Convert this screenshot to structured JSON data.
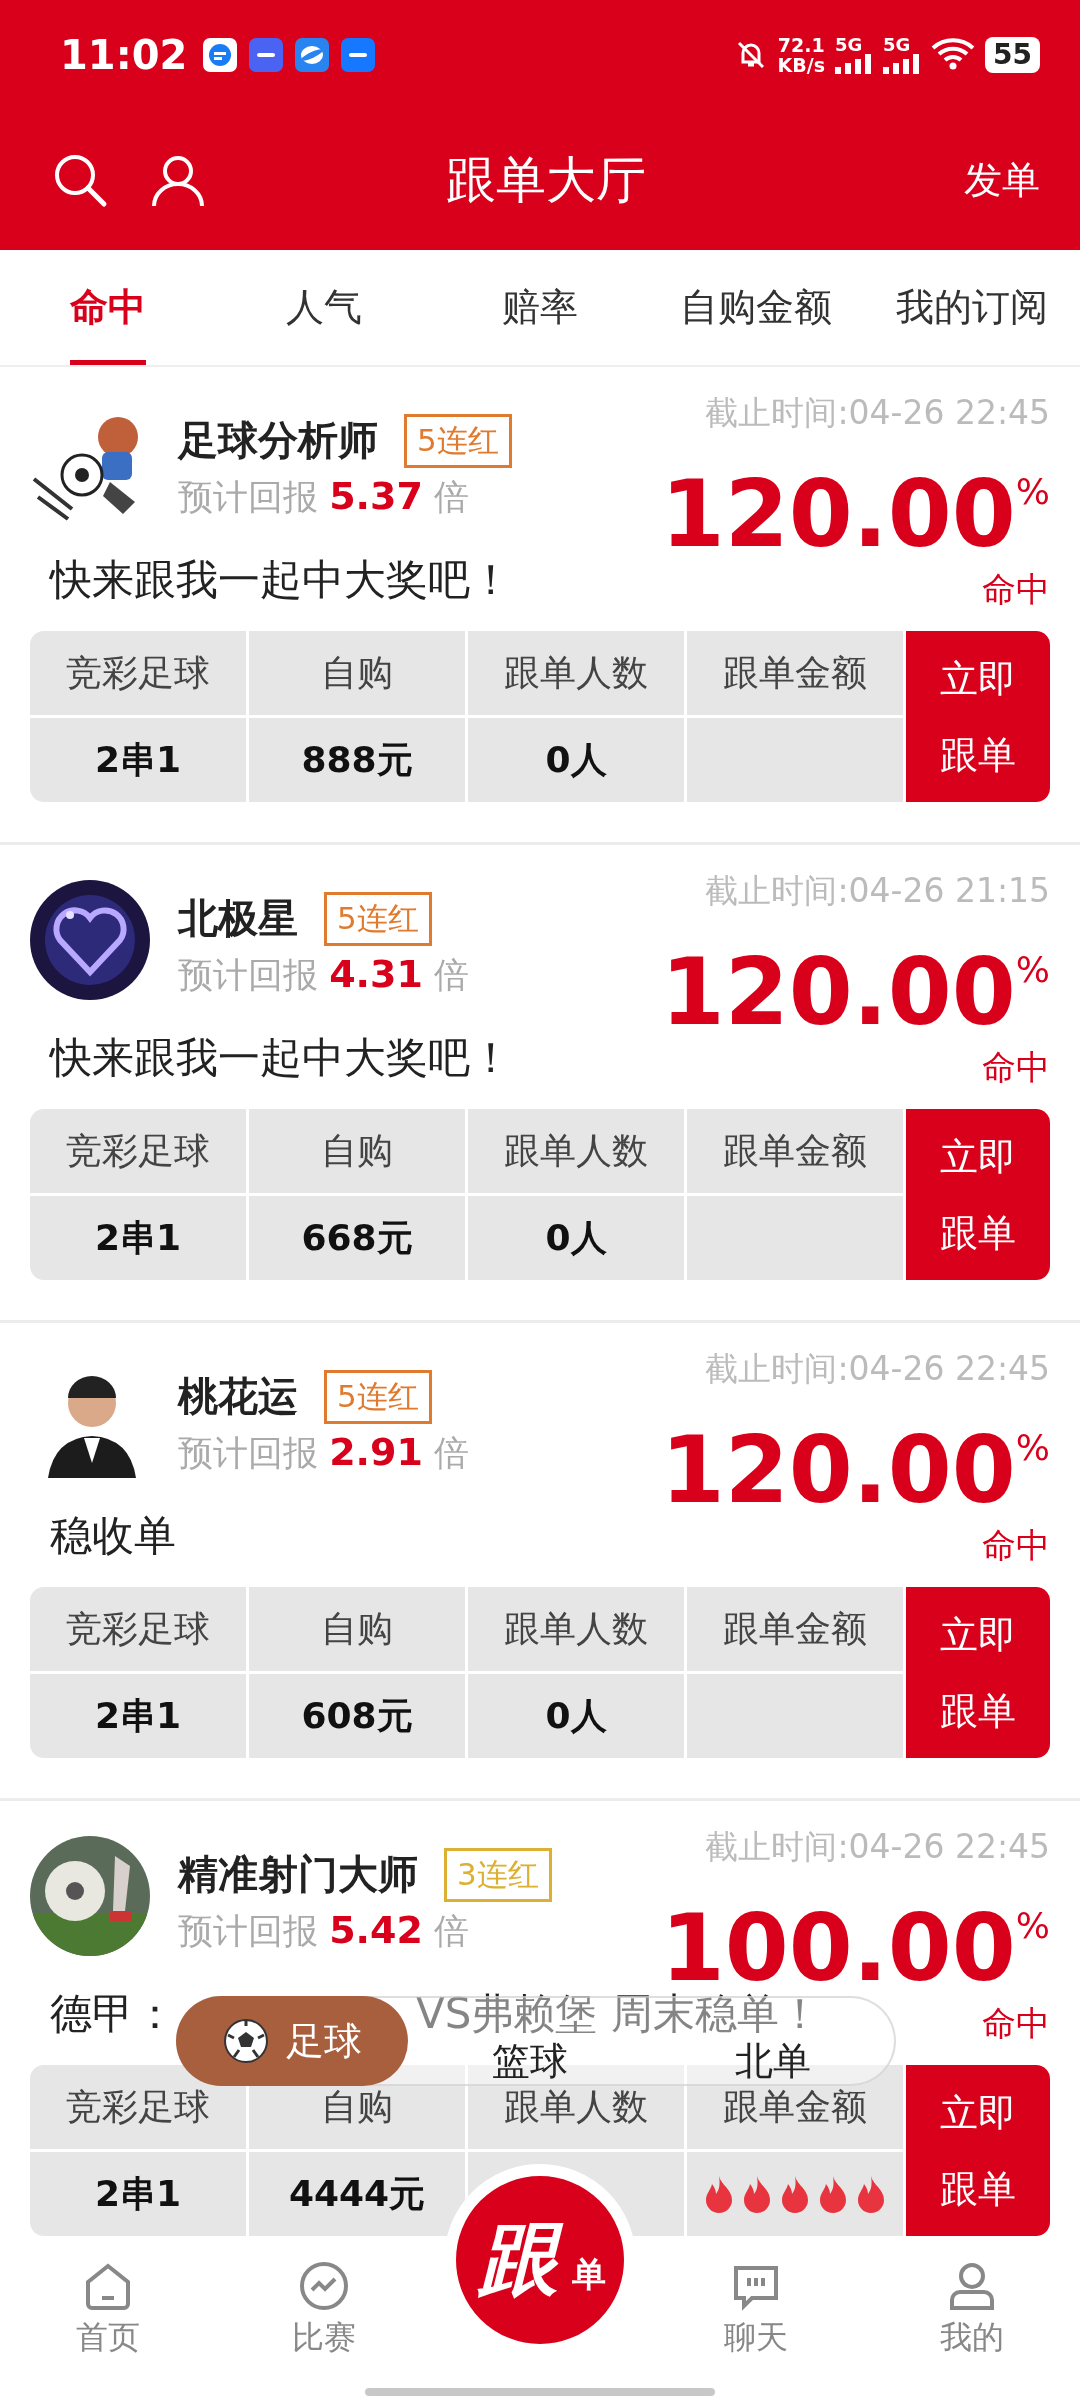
{
  "status_bar": {
    "time": "11:02",
    "speed_value": "72.1",
    "speed_unit": "KB/s",
    "networks": [
      "5G",
      "5G"
    ],
    "battery": "55"
  },
  "header": {
    "title": "跟单大厅",
    "action": "发单"
  },
  "tabs": [
    {
      "label": "命中",
      "selected": true
    },
    {
      "label": "人气",
      "selected": false
    },
    {
      "label": "赔率",
      "selected": false
    },
    {
      "label": "自购金额",
      "selected": false
    },
    {
      "label": "我的订阅",
      "selected": false
    }
  ],
  "cards": [
    {
      "name": "足球分析师",
      "streak": "5连红",
      "color": "#e07a2e",
      "return_text": "预计回报 **5.37** 倍",
      "deadline": "截止时间:04-26 22:45",
      "rate": "120.00$^{%}$",
      "rate_label": "命中",
      "slogan": [
        "快来跟我一起中大奖吧！"
      ],
      "cells": [
        {
          "header": "竞彩足球",
          "value": "2串1"
        },
        {
          "header": "自购",
          "value": "888元"
        },
        {
          "header": "跟单人数",
          "value": "0人"
        },
        {
          "header": "跟单金额"
        }
      ],
      "button": "立即跟单"
    },
    {
      "name": "北极星",
      "streak": "5连红",
      "color": "#e07a2e",
      "return_text": "预计回报 **4.31** 倍",
      "deadline": "截止时间:04-26 21:15",
      "rate": "120.00$^{%}$",
      "rate_label": "命中",
      "slogan": [
        "快来跟我一起中大奖吧！"
      ],
      "cells": [
        {
          "header": "竞彩足球",
          "value": "2串1"
        },
        {
          "header": "自购",
          "value": "668元"
        },
        {
          "header": "跟单人数",
          "value": "0人"
        },
        {
          "header": "跟单金额"
        }
      ],
      "button": "立即跟单"
    },
    {
      "name": "桃花运",
      "streak": "5连红",
      "color": "#e07a2e",
      "return_text": "预计回报 **2.91** 倍",
      "deadline": "截止时间:04-26 22:45",
      "rate": "120.00$^{%}$",
      "rate_label": "命中",
      "slogan": [
        "稳收单"
      ],
      "cells": [
        {
          "header": "竞彩足球",
          "value": "2串1"
        },
        {
          "header": "自购",
          "value": "608元"
        },
        {
          "header": "跟单人数",
          "value": "0人"
        },
        {
          "header": "跟单金额"
        }
      ],
      "button": "立即跟单"
    },
    {
      "name": "精准射门大师",
      "streak": "3连红",
      "color": "#dcb032",
      "return_text": "预计回报 **5.42** 倍",
      "deadline": "截止时间:04-26 22:45",
      "rate": "100.00$^{%}$",
      "rate_label": "命中",
      "slogan": [
        "德甲：",
        "VS弗赖堡 周末稳单！"
      ],
      "cells": [
        {
          "header": "竞彩足球",
          "value": "2串1"
        },
        {
          "header": "自购",
          "value": "4444元"
        },
        {
          "header": "跟单人数"
        },
        {
          "header": "跟单金额",
          "stars": 5
        }
      ],
      "button": "立即跟单"
    }
  ],
  "sport_switch": [
    {
      "label": "足球",
      "selected": true
    },
    {
      "label": "篮球",
      "selected": false
    },
    {
      "label": "北单",
      "selected": false
    }
  ],
  "fab": {
    "main": "跟",
    "sub": "单"
  },
  "bottom_nav": [
    {
      "label": "首页"
    },
    {
      "label": "比赛"
    },
    {
      "label": "聊天"
    },
    {
      "label": "我的"
    }
  ]
}
